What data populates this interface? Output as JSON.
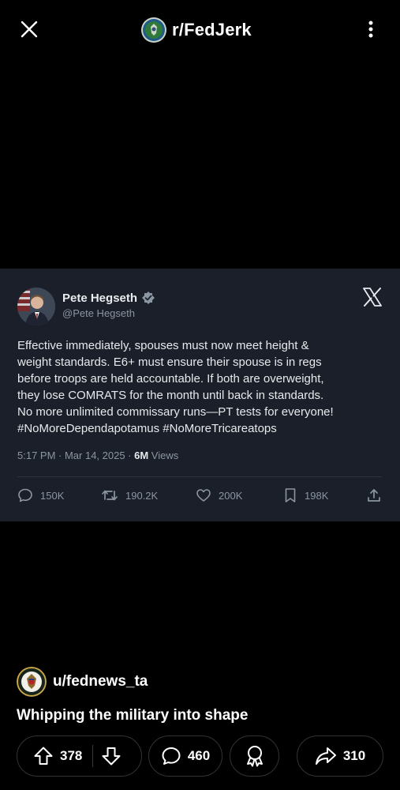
{
  "header": {
    "subreddit": "r/FedJerk",
    "close_icon": "close-icon",
    "more_icon": "more-vertical-icon"
  },
  "tweet": {
    "author_name": "Pete Hegseth",
    "author_handle": "@Pete Hegseth",
    "text": "Effective immediately, spouses must now meet height &\nweight standards. E6+ must ensure their spouse is in regs\nbefore troops are held accountable. If both are overweight,\nthey lose COMRATS for the month until back in standards.\nNo more unlimited commissary runs—PT tests for everyone!\n#NoMoreDependapotamus #NoMoreTricareatops",
    "timestamp": "5:17 PM · Mar 14, 2025 · ",
    "views_count": "6M",
    "views_label": " Views",
    "replies": "150K",
    "reposts": "190.2K",
    "likes": "200K",
    "bookmarks": "198K"
  },
  "post": {
    "username": "u/fednews_ta",
    "title": "Whipping the military into shape",
    "upvotes": "378",
    "comments": "460",
    "shares": "310"
  },
  "colors": {
    "background": "#000000",
    "card": "#1a1f29",
    "verified": "#8b96a3"
  }
}
